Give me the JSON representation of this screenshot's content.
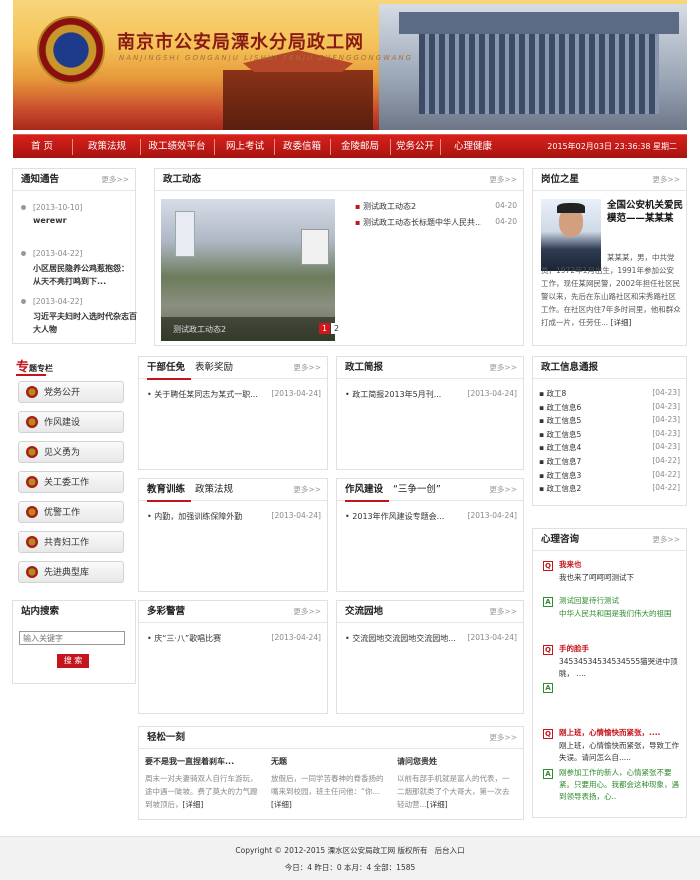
{
  "header": {
    "title": "南京市公安局溧水分局政工网",
    "subtitle": "NANJINGSHI GONGANJU LISHUI FENJU ZHENGGONGWANG"
  },
  "nav": {
    "items": [
      "首 页",
      "政策法规",
      "政工绩效平台",
      "网上考试",
      "政委信箱",
      "金陵邮局",
      "党务公开",
      "心理健康"
    ],
    "datetime": "2015年02月03日 23:36:38 星期二"
  },
  "more": "更多>>",
  "notice": {
    "title": "通知通告",
    "items": [
      {
        "date": "[2013-10-10]",
        "text": "werewr"
      },
      {
        "date": "[2013-04-22]",
        "text": "小区居民隐养公鸡惹抱怨：从天不亮打鸣到下..."
      },
      {
        "date": "[2013-04-22]",
        "text": "习近平夫妇时入选时代杂志百大人物"
      }
    ]
  },
  "news": {
    "title": "政工动态",
    "caption": "测试政工动态2",
    "pages": [
      "1",
      "2"
    ],
    "items": [
      {
        "text": "测试政工动态2",
        "date": "04-20"
      },
      {
        "text": "测试政工动态长标题中华人民共...",
        "date": "04-20"
      }
    ]
  },
  "star": {
    "title": "岗位之星",
    "name": "全国公安机关爱民模范——某某某",
    "desc": "某某某，男，中共党员，1972年1月出生，1991年参加公安工作，现任某网民警，2002年担任社区民警以来，先后在东山路社区和宋秀路社区工作。在社区内住7年多时间里，他和群众打成一片，任劳任...",
    "detail": "[详细]"
  },
  "special": {
    "title": "专题专栏",
    "items": [
      "党务公开",
      "作风建设",
      "见义勇为",
      "关工委工作",
      "优警工作",
      "共青妇工作",
      "先进典型库"
    ]
  },
  "search": {
    "title": "站内搜索",
    "placeholder": "输入关键字",
    "button": "搜 索"
  },
  "cadre": {
    "tabs": [
      "干部任免",
      "表彰奖励"
    ],
    "items": [
      {
        "text": "关于聘任某同志为某式一职...",
        "date": "[2013-04-24]"
      }
    ]
  },
  "brief": {
    "title": "政工简报",
    "items": [
      {
        "text": "政工简报2013年5月刊...",
        "date": "[2013-04-24]"
      }
    ]
  },
  "info": {
    "title": "政工信息通报",
    "items": [
      {
        "text": "政工8",
        "date": "[04-23]"
      },
      {
        "text": "政工信息6",
        "date": "[04-23]"
      },
      {
        "text": "政工信息5",
        "date": "[04-23]"
      },
      {
        "text": "政工信息5",
        "date": "[04-23]"
      },
      {
        "text": "政工信息4",
        "date": "[04-23]"
      },
      {
        "text": "政工信息7",
        "date": "[04-22]"
      },
      {
        "text": "政工信息3",
        "date": "[04-22]"
      },
      {
        "text": "政工信息2",
        "date": "[04-22]"
      }
    ]
  },
  "edu": {
    "tabs": [
      "教育训练",
      "政策法规"
    ],
    "items": [
      {
        "text": "内勤，加强训练保障外勤",
        "date": "[2013-04-24]"
      }
    ]
  },
  "style": {
    "tabs": [
      "作风建设",
      "“三争一创”"
    ],
    "items": [
      {
        "text": "2013年作风建设专题会...",
        "date": "[2013-04-24]"
      }
    ]
  },
  "psy": {
    "title": "心理咨询",
    "items": [
      {
        "q": "我来也",
        "a": "我也来了呵呵呵测试下"
      },
      {
        "q": "测试回复待行测试",
        "a": "中华人民共和国是我们伟大的祖国"
      },
      {
        "q": "手的脸手",
        "a": "34534534534534555猫哭进中顶眺，  ...."
      },
      {
        "q": "",
        "a": ""
      },
      {
        "q": "刚上班，心情愉快而紧张，....",
        "a": "刚上班，心情愉快而紧张，导致工作失误。请问怎么自....."
      },
      {
        "q": "刚参加工作的新人，心情紧张不要紧。只要用心。我都会这种现象，遇到领导表扬，心..",
        "a": ""
      }
    ]
  },
  "colorful": {
    "title": "多彩警营",
    "items": [
      {
        "text": "庆“三·八”歌唱比赛",
        "date": "[2013-04-24]"
      }
    ]
  },
  "garden": {
    "title": "交流园地",
    "items": [
      {
        "text": "交流园地交流园地交流园地...",
        "date": "[2013-04-24]"
      }
    ]
  },
  "relax": {
    "title": "轻松一刻",
    "cols": [
      {
        "title": "要不是我一直捏着刹车...",
        "text": "周末一对夫妻骑双人自行车游玩，途中遇一陡坡。费了莫大的力气蹬到坡顶后，",
        "detail": "[详细]"
      },
      {
        "title": "无题",
        "text": "放假后，一同学苦春神的脊香扬的嘴来到校园，班主任问他：“你...",
        "detail": "[详细]"
      },
      {
        "title": "请问您贵姓",
        "text": "以前有部手机就是富人的代表，一二烟那就类了个大哥大，第一次去轻动营...",
        "detail": "[详细]"
      }
    ]
  },
  "footer": {
    "copy": "Copyright © 2012-2015 溧水区公安局政工网 版权所有",
    "admin": "后台入口",
    "stats": "今日：4 昨日：0 本月：4 全部：1585"
  },
  "colors": {
    "red": "#c4141c",
    "navRed": "#b8150f"
  }
}
